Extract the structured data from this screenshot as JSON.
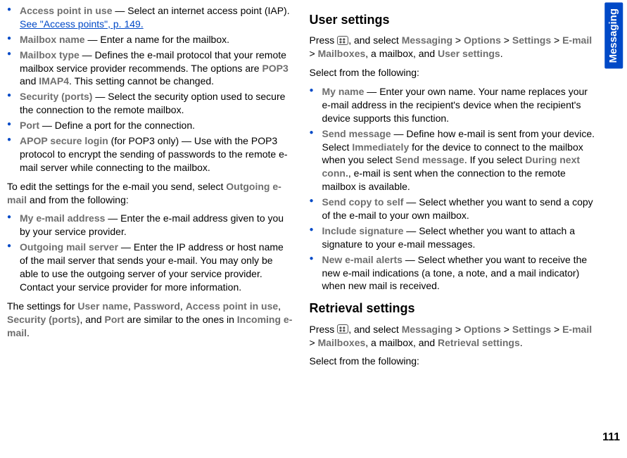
{
  "sideTab": {
    "label": "Messaging",
    "pageNumber": "111"
  },
  "left": {
    "list1": [
      {
        "label": "Access point in use",
        "text": "  — Select an internet access point (IAP). ",
        "link": "See \"Access points\", p. 149."
      },
      {
        "label": "Mailbox name",
        "text": "  — Enter a name for the mailbox."
      },
      {
        "label": "Mailbox type",
        "text": "  — Defines the e-mail protocol that your remote mailbox service provider recommends. The options are ",
        "opt1": "POP3",
        "mid": " and ",
        "opt2": "IMAP4",
        "tail": ". This setting cannot be changed."
      },
      {
        "label": "Security (ports)",
        "text": "  — Select the security option used to secure the connection to the remote mailbox."
      },
      {
        "label": "Port",
        "text": "  — Define a port for the connection."
      },
      {
        "label": "APOP secure login",
        "text": " (for POP3 only) — Use with the POP3 protocol to encrypt the sending of passwords to the remote e-mail server while connecting to the mailbox."
      }
    ],
    "para1a": "To edit the settings for the e-mail you send, select ",
    "para1b": "Outgoing e-mail",
    "para1c": " and from the following:",
    "list2": [
      {
        "label": "My e-mail address",
        "text": "  — Enter the e-mail address given to you by your service provider."
      },
      {
        "label": "Outgoing mail server",
        "text": "  — Enter the IP address or host name of the mail server that sends your e-mail. You may only be able to use the outgoing server of your service provider. Contact your service provider for more information."
      }
    ],
    "para2": {
      "a": "The settings for ",
      "b": "User name",
      "c": ", ",
      "d": "Password",
      "e": ", ",
      "f": "Access point in use",
      "g": ", ",
      "h": "Security (ports)",
      "i": ", and ",
      "j": "Port",
      "k": " are similar to the ones in ",
      "l": "Incoming e-mail",
      "m": "."
    }
  },
  "right": {
    "heading1": "User settings",
    "press1": {
      "a": "Press ",
      "b": ", and select ",
      "c": "Messaging",
      "d": " > ",
      "e": "Options",
      "f": " > ",
      "g": "Settings",
      "h": " > ",
      "i": "E-mail",
      "j": " > ",
      "k": "Mailboxes",
      "l": ", a mailbox, and ",
      "m": "User settings",
      "n": "."
    },
    "selectText": "Select from the following:",
    "list3": [
      {
        "label": "My name",
        "text": "  — Enter your own name. Your name replaces your e-mail address in the recipient's device when the recipient's device supports this function."
      },
      {
        "label": "Send message",
        "text": " — Define how e-mail is sent from your device. Select ",
        "b1": "Immediately",
        "t2": " for the device to connect to the mailbox when you select ",
        "b2": "Send message",
        "t3": ". If you select ",
        "b3": "During next conn.",
        "t4": ", e-mail is sent when the connection to the remote mailbox is available."
      },
      {
        "label": "Send copy to self",
        "text": "  — Select whether you want to send a copy of the e-mail to your own mailbox."
      },
      {
        "label": "Include signature",
        "text": "  — Select whether you want to attach a signature to your e-mail messages."
      },
      {
        "label": "New e-mail alerts",
        "text": "  — Select whether you want to receive the new e-mail indications (a tone, a note, and a mail indicator) when new mail is received."
      }
    ],
    "heading2": "Retrieval settings",
    "press2": {
      "a": "Press ",
      "b": ", and select ",
      "c": "Messaging",
      "d": " > ",
      "e": "Options",
      "f": " > ",
      "g": "Settings",
      "h": " > ",
      "i": "E-mail",
      "j": " > ",
      "k": "Mailboxes",
      "l": ", a mailbox, and ",
      "m": "Retrieval settings",
      "n": "."
    },
    "selectText2": "Select from the following:"
  }
}
